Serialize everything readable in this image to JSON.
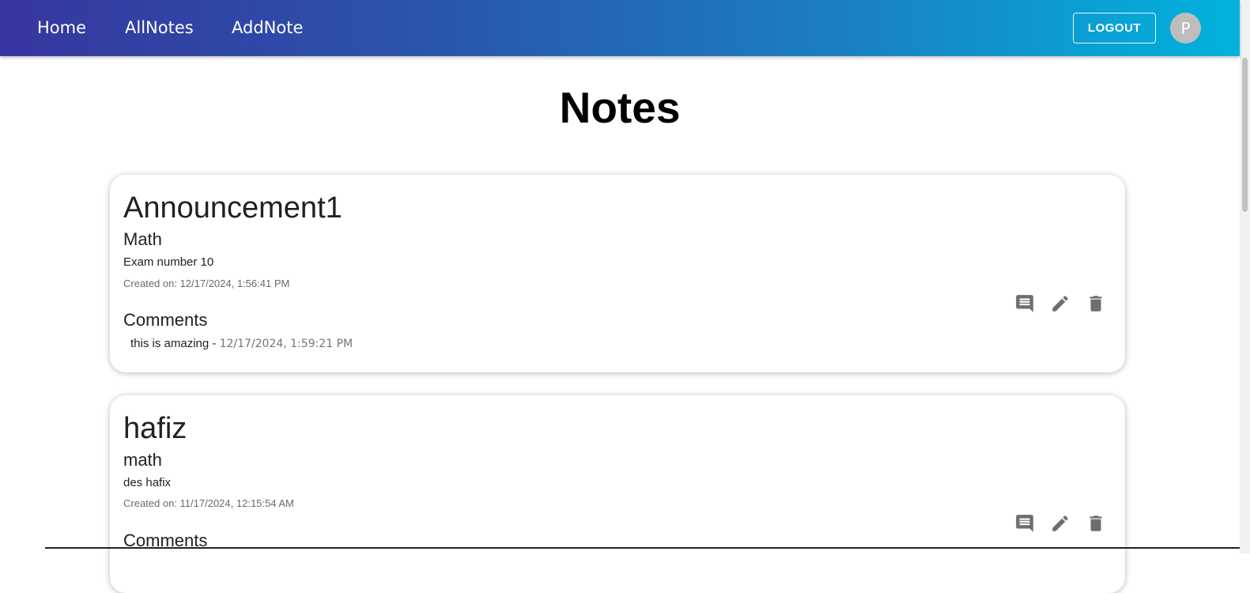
{
  "nav": {
    "links": [
      "Home",
      "AllNotes",
      "AddNote"
    ],
    "logout_label": "LOGOUT",
    "avatar_initial": "P"
  },
  "page": {
    "title": "Notes"
  },
  "notes": [
    {
      "title": "Announcement1",
      "subject": "Math",
      "description": "Exam number 10",
      "created": "Created on: 12/17/2024, 1:56:41 PM",
      "comments_heading": "Comments",
      "comments": [
        {
          "text": "this is amazing",
          "separator": " - ",
          "date": "12/17/2024, 1:59:21 PM"
        }
      ],
      "actions": [
        "comment-icon",
        "edit-icon",
        "delete-icon"
      ]
    },
    {
      "title": "hafiz",
      "subject": "math",
      "description": "des hafix",
      "created": "Created on: 11/17/2024, 12:15:54 AM",
      "comments_heading": "Comments",
      "comments": [],
      "actions": [
        "comment-icon",
        "edit-icon",
        "delete-icon"
      ]
    }
  ],
  "colors": {
    "nav_gradient_start": "#36369f",
    "nav_gradient_end": "#00b3dd",
    "icon": "#6e6e6e",
    "avatar_bg": "#bdbdbd"
  }
}
